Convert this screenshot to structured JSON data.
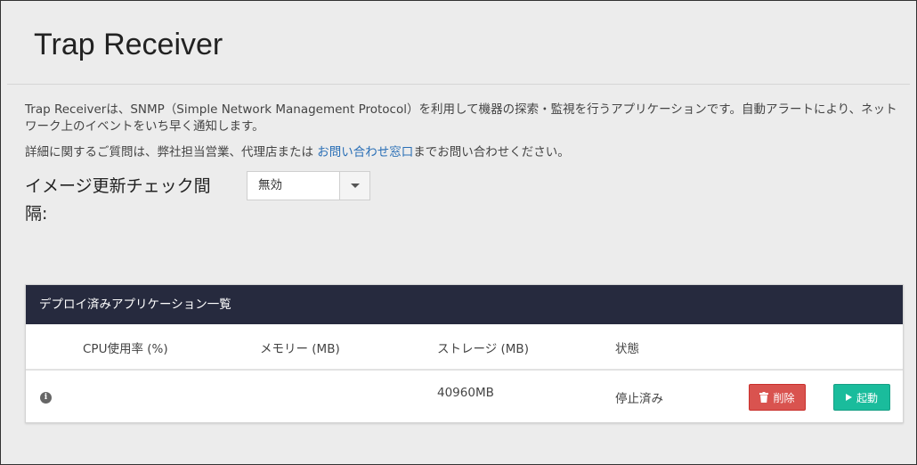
{
  "page": {
    "title": "Trap Receiver",
    "description_1": "Trap Receiverは、SNMP（Simple Network Management Protocol）を利用して機器の探索・監視を行うアプリケーションです。自動アラートにより、ネットワーク上のイベントをいち早く通知します。",
    "description_2_prefix": "詳細に関するご質問は、弊社担当営業、代理店または ",
    "description_2_link": "お問い合わせ窓口",
    "description_2_suffix": "までお問い合わせください。"
  },
  "image_check": {
    "label": "イメージ更新チェック間隔:",
    "selected": "無効",
    "caret_icon": "caret-down-icon"
  },
  "apps_panel": {
    "title": "デプロイ済みアプリケーション一覧",
    "columns": {
      "cpu": "CPU使用率 (%)",
      "memory": "メモリー (MB)",
      "storage": "ストレージ (MB)",
      "status": "状態"
    },
    "rows": [
      {
        "info_icon": "i",
        "cpu": "",
        "memory": "",
        "storage": "40960MB",
        "status": "停止済み",
        "delete_label": "削除",
        "start_label": "起動"
      }
    ]
  },
  "colors": {
    "header_bg": "#262a3e",
    "delete": "#d9534f",
    "start": "#1abc9c",
    "link": "#2a6fb6",
    "background": "#ececec"
  }
}
